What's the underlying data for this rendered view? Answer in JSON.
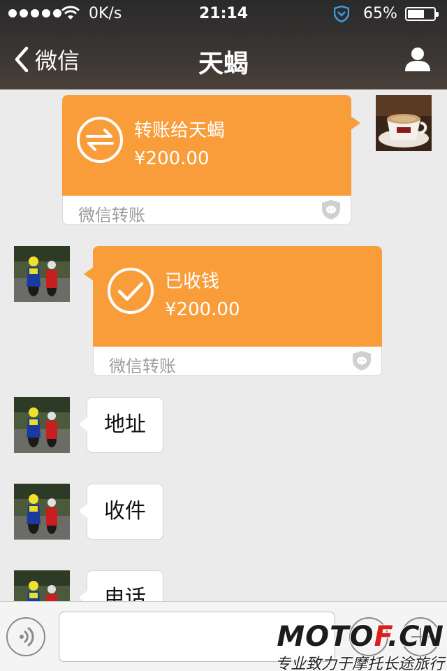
{
  "status_bar": {
    "network_speed": "0K/s",
    "time": "21:14",
    "battery_percent": "65%",
    "battery_level": 0.65
  },
  "nav": {
    "back_label": "微信",
    "title": "天蝎"
  },
  "messages": {
    "transfer_sent": {
      "title": "转账给天蝎",
      "amount": "¥200.00",
      "footer": "微信转账"
    },
    "transfer_received": {
      "title": "已收钱",
      "amount": "¥200.00",
      "footer": "微信转账"
    },
    "text_1": "地址",
    "text_2": "收件",
    "text_3": "电话"
  },
  "watermark": {
    "logo_main": "MOTO",
    "logo_accent": "F",
    "logo_tail": ".CN",
    "tagline": "专业致力于摩托长途旅行"
  },
  "colors": {
    "transfer_orange": "#f99d3a",
    "chat_background": "#ebebeb",
    "topbar": "#2a2a2a"
  },
  "icons": {
    "back": "chevron-left-icon",
    "profile": "person-icon",
    "transfer": "transfer-arrows-icon",
    "received": "checkmark-icon",
    "voice": "voice-icon",
    "emoji": "emoji-icon",
    "plus": "plus-icon"
  }
}
